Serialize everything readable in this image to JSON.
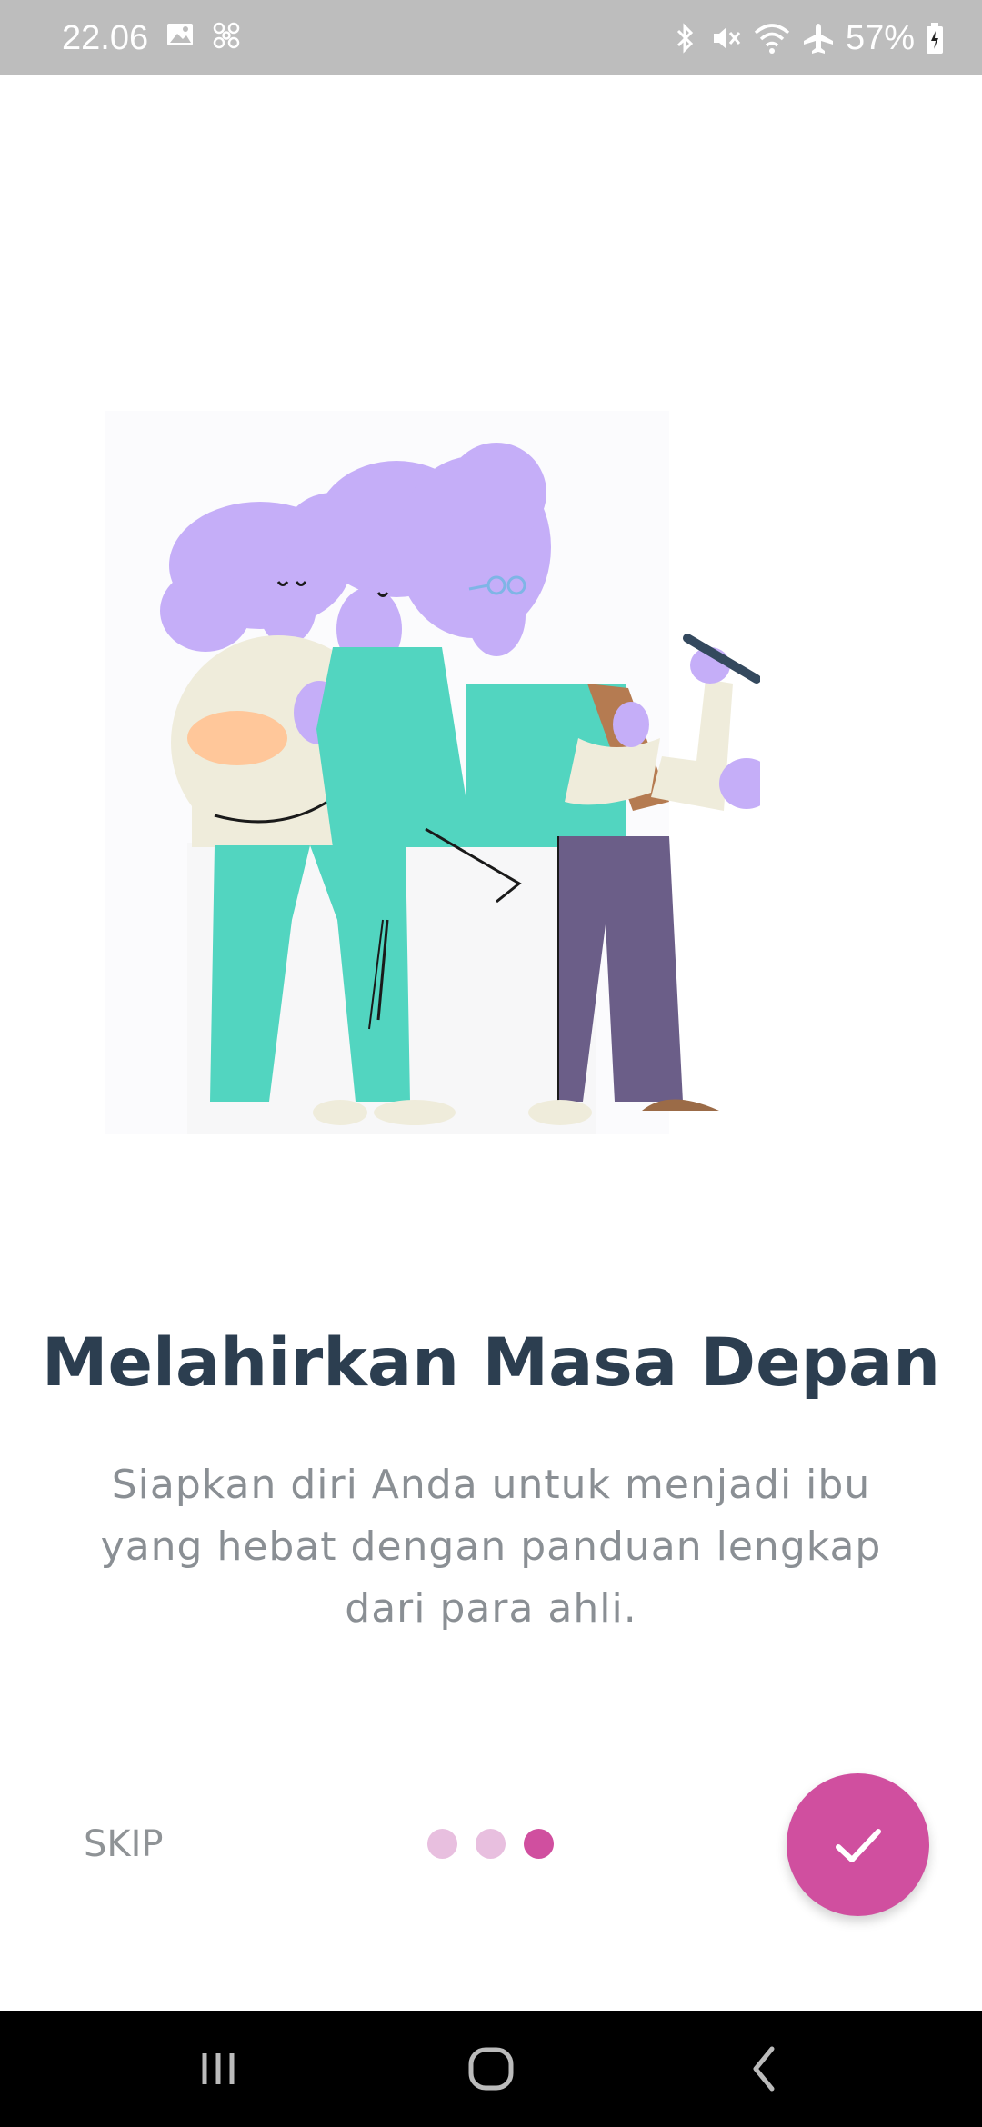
{
  "status_bar": {
    "time": "22.06",
    "battery_percent": "57%",
    "left_icons": [
      "image-icon",
      "fan-icon"
    ],
    "right_icons": [
      "bluetooth-icon",
      "mute-icon",
      "wifi-icon",
      "airplane-icon",
      "battery-icon"
    ]
  },
  "onboarding": {
    "title": "Melahirkan Masa Depan",
    "description": "Siapkan diri Anda untuk menjadi ibu yang hebat dengan panduan lengkap dari para ahli.",
    "skip_label": "SKIP",
    "page_count": 3,
    "active_page": 3,
    "finish_icon": "check-icon"
  },
  "colors": {
    "accent": "#d04f9f",
    "dot_inactive": "#e8bfdf",
    "title": "#2c3e50",
    "body_text": "#8a8f94"
  },
  "nav_bar": {
    "buttons": [
      "recents-icon",
      "home-icon",
      "back-icon"
    ]
  }
}
